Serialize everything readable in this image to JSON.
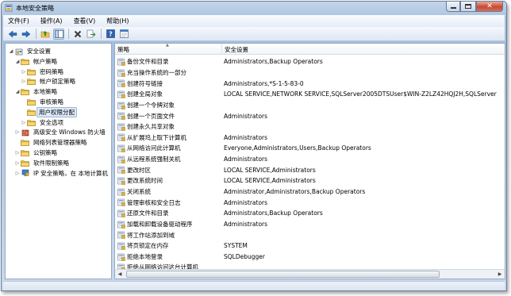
{
  "window": {
    "title": "本地安全策略"
  },
  "menubar": [
    "文件(F)",
    "操作(A)",
    "查看(V)",
    "帮助(H)"
  ],
  "tree": [
    {
      "label": "安全设置",
      "level": 0,
      "arrow": "open",
      "icon": "security-settings-icon"
    },
    {
      "label": "帐户策略",
      "level": 1,
      "arrow": "open",
      "icon": "folder-icon"
    },
    {
      "label": "密码策略",
      "level": 2,
      "arrow": "closed",
      "icon": "folder-icon"
    },
    {
      "label": "帐户锁定策略",
      "level": 2,
      "arrow": "closed",
      "icon": "folder-icon"
    },
    {
      "label": "本地策略",
      "level": 1,
      "arrow": "open",
      "icon": "folder-icon"
    },
    {
      "label": "审核策略",
      "level": 2,
      "arrow": "none",
      "icon": "folder-icon"
    },
    {
      "label": "用户权限分配",
      "level": 2,
      "arrow": "none",
      "icon": "folder-icon",
      "selected": true
    },
    {
      "label": "安全选项",
      "level": 2,
      "arrow": "closed",
      "icon": "folder-icon"
    },
    {
      "label": "高级安全 Windows 防火墙",
      "level": 1,
      "arrow": "closed",
      "icon": "firewall-icon"
    },
    {
      "label": "网络列表管理器策略",
      "level": 1,
      "arrow": "none",
      "icon": "folder-icon"
    },
    {
      "label": "公钥策略",
      "level": 1,
      "arrow": "closed",
      "icon": "folder-icon"
    },
    {
      "label": "软件限制策略",
      "level": 1,
      "arrow": "closed",
      "icon": "folder-icon"
    },
    {
      "label": "IP 安全策略，在 本地计算机",
      "level": 1,
      "arrow": "closed",
      "icon": "ip-security-icon"
    }
  ],
  "columns": {
    "policy": "策略",
    "setting": "安全设置"
  },
  "policies": [
    {
      "name": "备份文件和目录",
      "value": "Administrators,Backup Operators"
    },
    {
      "name": "充当操作系统的一部分",
      "value": ""
    },
    {
      "name": "创建符号链接",
      "value": "Administrators,*S-1-5-83-0"
    },
    {
      "name": "创建全局对象",
      "value": "LOCAL SERVICE,NETWORK SERVICE,SQLServer2005DTSUser$WIN-Z2LZ42HQJ2H,SQLServer"
    },
    {
      "name": "创建一个令牌对象",
      "value": ""
    },
    {
      "name": "创建一个页面文件",
      "value": "Administrators"
    },
    {
      "name": "创建永久共享对象",
      "value": ""
    },
    {
      "name": "从扩展坞上取下计算机",
      "value": "Administrators"
    },
    {
      "name": "从网络访问此计算机",
      "value": "Everyone,Administrators,Users,Backup Operators"
    },
    {
      "name": "从远程系统强制关机",
      "value": "Administrators"
    },
    {
      "name": "更改时区",
      "value": "LOCAL SERVICE,Administrators"
    },
    {
      "name": "更改系统时间",
      "value": "LOCAL SERVICE,Administrators"
    },
    {
      "name": "关闭系统",
      "value": "Administrator,Administrators,Backup Operators"
    },
    {
      "name": "管理审核和安全日志",
      "value": "Administrators"
    },
    {
      "name": "还原文件和目录",
      "value": "Administrators,Backup Operators"
    },
    {
      "name": "加载和卸载设备驱动程序",
      "value": "Administrators"
    },
    {
      "name": "将工作站添加到域",
      "value": ""
    },
    {
      "name": "将页锁定在内存",
      "value": "SYSTEM"
    },
    {
      "name": "拒绝本地登录",
      "value": "SQLDebugger"
    },
    {
      "name": "拒绝从网络访问这台计算机",
      "value": ""
    }
  ],
  "colors": {
    "accent": "#3c7fc4",
    "folder": "#f0c24a",
    "selection": "#dde9f7"
  }
}
